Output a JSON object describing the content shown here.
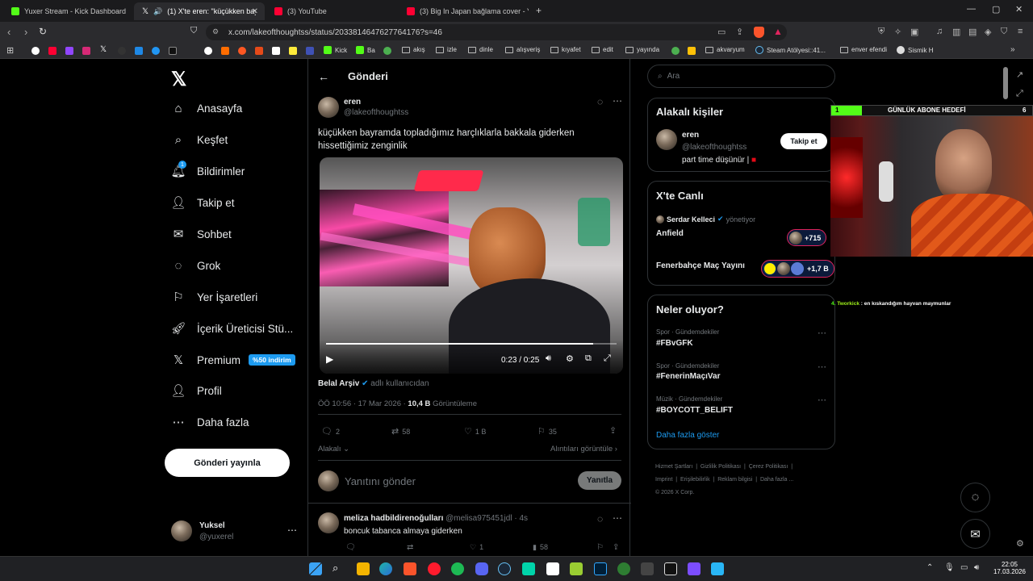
{
  "browser": {
    "tabs": [
      {
        "title": "Yuxer Stream - Kick Dashboard",
        "color": "#53fc18"
      },
      {
        "title": "(1) X'te eren: \"küçükken bayra",
        "color": "#ffffff",
        "active": true
      },
      {
        "title": "(3) YouTube",
        "color": "#ff0033"
      },
      {
        "title": "(3) Big In Japan bağlama cover - YouT",
        "color": "#ff0033"
      }
    ],
    "new_tab_label": "+",
    "url": "x.com/lakeofthoughtss/status/2033814647627764176?s=46",
    "bookmarks": [
      {
        "label": "Kick",
        "kind": "site",
        "color": "#53fc18"
      },
      {
        "label": "Ba",
        "kind": "site",
        "color": "#53fc18"
      },
      {
        "label": "akış",
        "kind": "folder"
      },
      {
        "label": "izle",
        "kind": "folder"
      },
      {
        "label": "dinle",
        "kind": "folder"
      },
      {
        "label": "alışveriş",
        "kind": "folder"
      },
      {
        "label": "kıyafet",
        "kind": "folder"
      },
      {
        "label": "edit",
        "kind": "folder"
      },
      {
        "label": "yayında",
        "kind": "folder"
      },
      {
        "label": "akvaryum",
        "kind": "folder"
      },
      {
        "label": "Steam Atölyesi::41...",
        "kind": "site",
        "color": "#1b2838"
      },
      {
        "label": "enver efendi",
        "kind": "folder"
      },
      {
        "label": "Sismik H",
        "kind": "site",
        "color": "#dddddd"
      }
    ]
  },
  "sidebar": {
    "items": [
      {
        "label": "Anasayfa",
        "icon": "home-icon"
      },
      {
        "label": "Keşfet",
        "icon": "search-icon"
      },
      {
        "label": "Bildirimler",
        "icon": "bell-icon",
        "badge": "1"
      },
      {
        "label": "Takip et",
        "icon": "follow-icon"
      },
      {
        "label": "Sohbet",
        "icon": "mail-icon"
      },
      {
        "label": "Grok",
        "icon": "grok-icon"
      },
      {
        "label": "Yer İşaretleri",
        "icon": "bookmark-icon"
      },
      {
        "label": "İçerik Üreticisi Stü...",
        "icon": "rocket-icon"
      },
      {
        "label": "Premium",
        "icon": "x-logo-icon",
        "badge": "%50 indirim"
      },
      {
        "label": "Profil",
        "icon": "profile-icon"
      },
      {
        "label": "Daha fazla",
        "icon": "more-icon"
      }
    ],
    "post_button": "Gönderi yayınla",
    "account": {
      "name": "Yuksel",
      "handle": "@yuxerel"
    }
  },
  "post": {
    "header_title": "Gönderi",
    "author_name": "eren",
    "author_handle": "@lakeofthoughtss",
    "text": "küçükken bayramda topladığımız harçlıklarla bakkala giderken hissettiğimiz zenginlik",
    "video_time": "0:23 / 0:25",
    "video_progress": 0.92,
    "source_name": "Belal Arşiv",
    "source_suffix": "adlı kullanıcıdan",
    "timestamp": "ÖÖ 10:56 · 17 Mar 2026 · ",
    "views_count": "10,4 B",
    "views_label": "Görüntüleme",
    "stats": {
      "replies": "2",
      "reposts": "58",
      "likes": "1 B",
      "bookmarks": "35"
    },
    "sort_label": "Alakalı",
    "quotes_link": "Alıntıları görüntüle",
    "reply_placeholder": "Yanıtını gönder",
    "reply_button": "Yanıtla"
  },
  "reply": {
    "name": "meliza hadbildirenoğulları",
    "handle": "@melisa975451jdl",
    "time": "· 4s",
    "text": "boncuk tabanca almaya giderken",
    "reposts": "1",
    "views": "58"
  },
  "right": {
    "search_placeholder": "Ara",
    "relevant_title": "Alakalı kişiler",
    "person": {
      "name": "eren",
      "handle": "@lakeofthoughtss",
      "bio": "part time düşünür |",
      "follow": "Takip et"
    },
    "live_title": "X'te Canlı",
    "live": [
      {
        "host": "Serdar Kelleci",
        "status": "yönetiyor",
        "title": "Anfield",
        "count": "+715"
      },
      {
        "title": "Fenerbahçe Maç Yayını",
        "count": "+1,7 B"
      }
    ],
    "trends_title": "Neler oluyor?",
    "trends": [
      {
        "category": "Spor · Gündemdekiler",
        "tag": "#FBvGFK"
      },
      {
        "category": "Spor · Gündemdekiler",
        "tag": "#FenerinMaçıVar"
      },
      {
        "category": "Müzik · Gündemdekiler",
        "tag": "#BOYCOTT_BELIFT"
      }
    ],
    "show_more": "Daha fazla göster",
    "footer": [
      "Hizmet Şartları",
      "|",
      "Gizlilik Politikası",
      "|",
      "Çerez Politikası",
      "|",
      "Imprint",
      "|",
      "Erişilebilirlik",
      "|",
      "Reklam bilgisi",
      "|",
      "Daha fazla ...",
      "© 2026 X Corp."
    ]
  },
  "overlay": {
    "goal_left": "1",
    "goal_title": "GÜNLÜK ABONE HEDEFİ",
    "goal_right": "6",
    "chat_user": "Tworkick",
    "chat_text": ": en kıskandığım hayvan maymunlar",
    "chat_prefix": "4."
  },
  "taskbar": {
    "time": "22:05",
    "date": "17.03.2026"
  },
  "colors": {
    "accent": "#1d9bf0",
    "background": "#000000",
    "border": "#2f3336",
    "muted": "#71767b",
    "kick": "#53fc18",
    "live_red": "#e0245e"
  }
}
